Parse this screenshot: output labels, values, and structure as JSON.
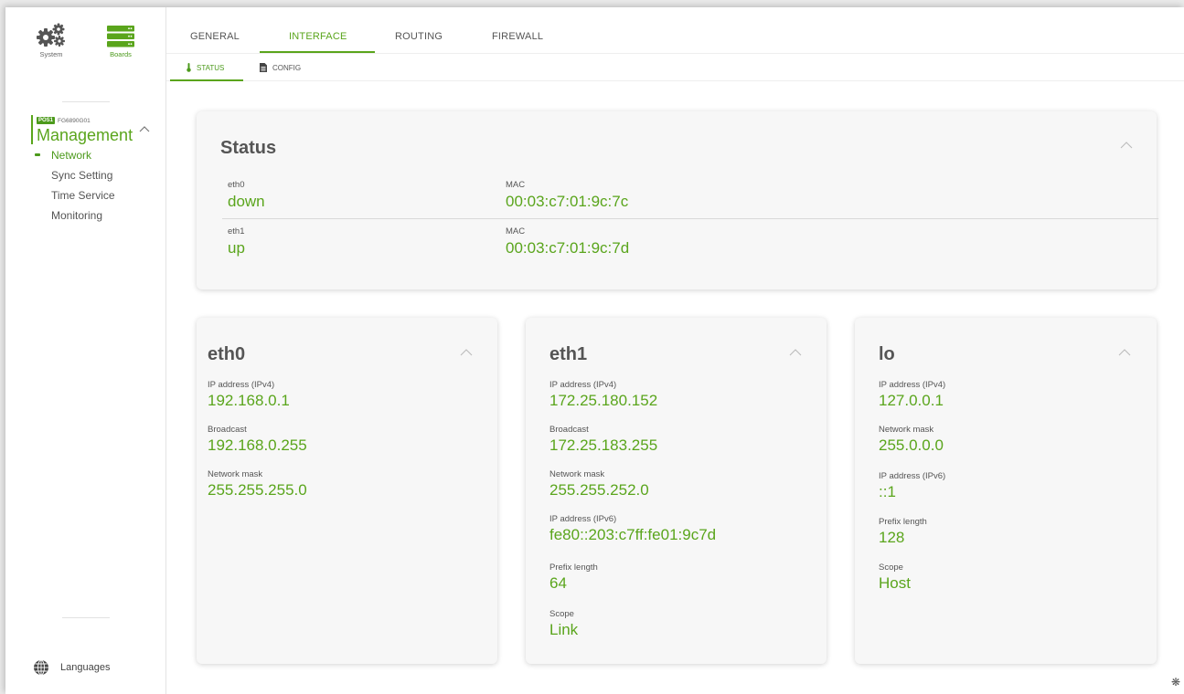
{
  "colors": {
    "accent": "#5aa51c",
    "text": "#555555"
  },
  "sidebar": {
    "modules": [
      {
        "label": "System",
        "icon": "gears-icon"
      },
      {
        "label": "Boards",
        "icon": "server-stack-icon"
      }
    ],
    "board": {
      "slot": "POS1",
      "id": "FG6890G01",
      "title": "Management"
    },
    "nav": [
      {
        "label": "Network",
        "active": true
      },
      {
        "label": "Sync Setting"
      },
      {
        "label": "Time Service"
      },
      {
        "label": "Monitoring"
      }
    ],
    "languages": "Languages"
  },
  "tabs": [
    "GENERAL",
    "INTERFACE",
    "ROUTING",
    "FIREWALL"
  ],
  "active_tab": "INTERFACE",
  "subtabs": [
    "STATUS",
    "CONFIG"
  ],
  "active_subtab": "STATUS",
  "status": {
    "title": "Status",
    "rows": [
      {
        "name": "eth0",
        "state": "down",
        "mac_label": "MAC",
        "mac": "00:03:c7:01:9c:7c"
      },
      {
        "name": "eth1",
        "state": "up",
        "mac_label": "MAC",
        "mac": "00:03:c7:01:9c:7d"
      }
    ]
  },
  "interfaces": [
    {
      "title": "eth0",
      "fields": [
        {
          "label": "IP address (IPv4)",
          "value": "192.168.0.1"
        },
        {
          "label": "Broadcast",
          "value": "192.168.0.255"
        },
        {
          "label": "Network mask",
          "value": "255.255.255.0"
        }
      ]
    },
    {
      "title": "eth1",
      "fields": [
        {
          "label": "IP address (IPv4)",
          "value": "172.25.180.152"
        },
        {
          "label": "Broadcast",
          "value": "172.25.183.255"
        },
        {
          "label": "Network mask",
          "value": "255.255.252.0"
        },
        {
          "label": "IP address (IPv6)",
          "value": "fe80::203:c7ff:fe01:9c7d"
        },
        {
          "label": "Prefix length",
          "value": "64"
        },
        {
          "label": "Scope",
          "value": "Link"
        }
      ]
    },
    {
      "title": "lo",
      "fields": [
        {
          "label": "IP address (IPv4)",
          "value": "127.0.0.1"
        },
        {
          "label": "Network mask",
          "value": "255.0.0.0"
        },
        {
          "label": "IP address (IPv6)",
          "value": "::1"
        },
        {
          "label": "Prefix length",
          "value": "128"
        },
        {
          "label": "Scope",
          "value": "Host"
        }
      ]
    }
  ]
}
